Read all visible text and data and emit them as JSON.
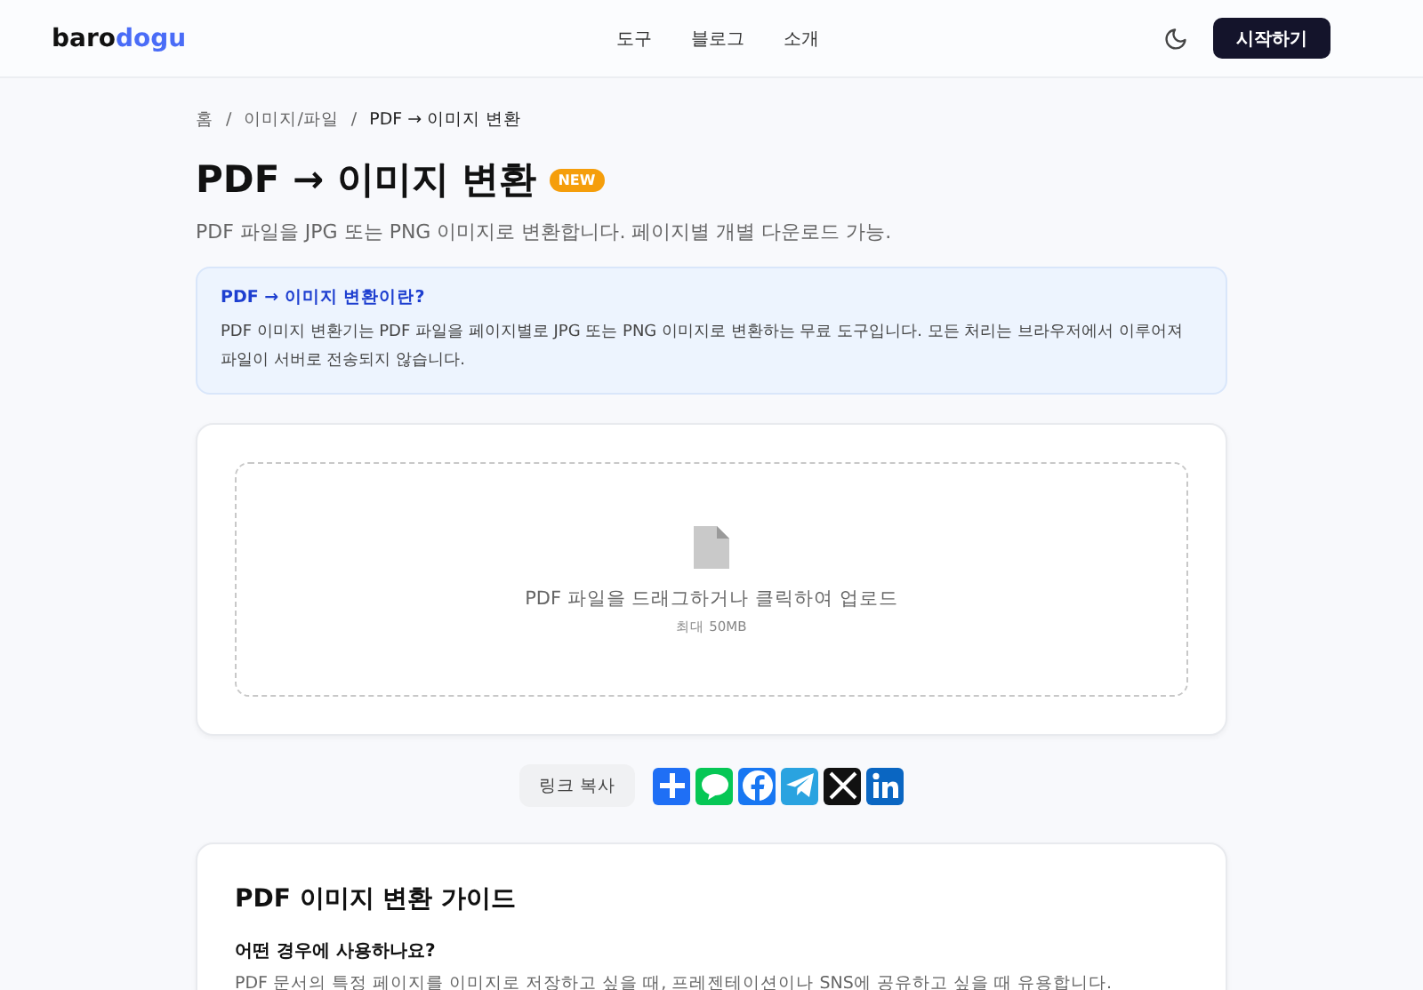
{
  "header": {
    "logo": {
      "part_1": "baro",
      "part_2": "dogu"
    },
    "nav": [
      {
        "label": "도구"
      },
      {
        "label": "블로그"
      },
      {
        "label": "소개"
      }
    ],
    "cta": "시작하기"
  },
  "breadcrumb": {
    "separator": "/",
    "items": [
      "홈",
      "이미지/파일",
      "PDF → 이미지 변환"
    ]
  },
  "title": "PDF → 이미지 변환",
  "badge": "NEW",
  "subtitle": "PDF 파일을 JPG 또는 PNG 이미지로 변환합니다. 페이지별 개별 다운로드 가능.",
  "info": {
    "heading": "PDF → 이미지 변환이란?",
    "text": "PDF 이미지 변환기는 PDF 파일을 페이지별로 JPG 또는 PNG 이미지로 변환하는 무료 도구입니다. 모든 처리는 브라우저에서 이루어져 파일이 서버로 전송되지 않습니다."
  },
  "upload": {
    "prompt": "PDF 파일을 드래그하거나 클릭하여 업로드",
    "limit": "최대 50MB"
  },
  "share": {
    "copy_link": "링크 복사",
    "buttons": [
      {
        "kind": "add",
        "color": "#1f6ff5"
      },
      {
        "kind": "line",
        "color": "#06c755"
      },
      {
        "kind": "facebook",
        "color": "#1877f2"
      },
      {
        "kind": "telegram",
        "color": "#2aa3e0"
      },
      {
        "kind": "x",
        "color": "#111111"
      },
      {
        "kind": "linkedin",
        "color": "#0a66c2"
      }
    ]
  },
  "guide": {
    "title": "PDF 이미지 변환 가이드",
    "sections": [
      {
        "question": "어떤 경우에 사용하나요?",
        "answer": "PDF 문서의 특정 페이지를 이미지로 저장하고 싶을 때, 프레젠테이션이나 SNS에 공유하고 싶을 때 유용합니다."
      }
    ]
  }
}
